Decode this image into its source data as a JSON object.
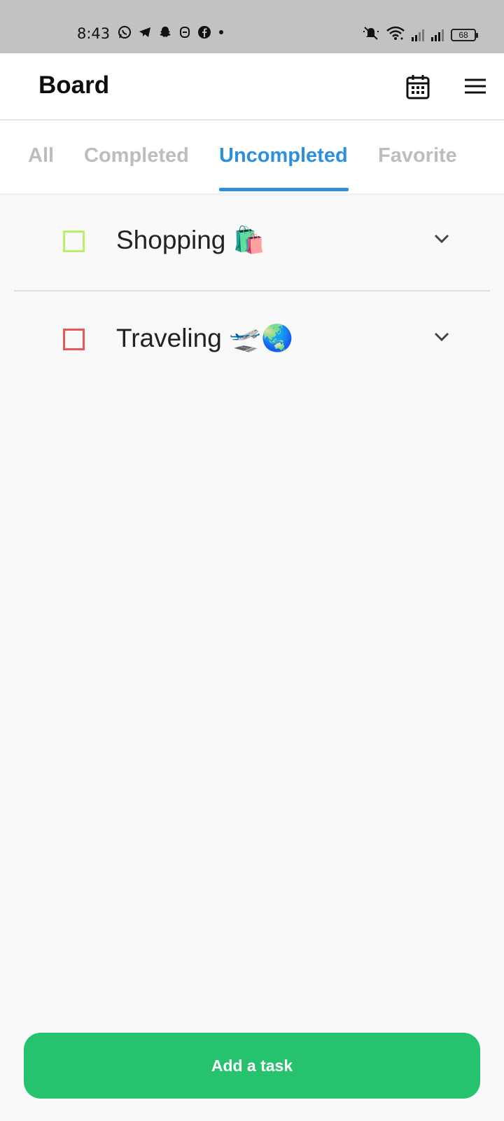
{
  "status_bar": {
    "time": "8:43",
    "left_icons": [
      "whatsapp-icon",
      "telegram-icon",
      "snapchat-icon",
      "notification-icon",
      "facebook-icon",
      "dot-icon"
    ],
    "right_icons": [
      "mute-icon",
      "wifi-icon",
      "signal-icon",
      "signal-icon-2"
    ],
    "battery": "68"
  },
  "app_bar": {
    "title": "Board"
  },
  "tabs": [
    {
      "label": "All",
      "active": false
    },
    {
      "label": "Completed",
      "active": false
    },
    {
      "label": "Uncompleted",
      "active": true
    },
    {
      "label": "Favorite",
      "active": false
    }
  ],
  "tasks": [
    {
      "title": "Shopping 🛍️",
      "checked": false,
      "color": "#b9f06a"
    },
    {
      "title": "Traveling 🛫🌏",
      "checked": false,
      "color": "#e9575a"
    }
  ],
  "add_button": {
    "label": "Add a task",
    "color": "#26c26d"
  },
  "accent_color": "#2e8fdc"
}
